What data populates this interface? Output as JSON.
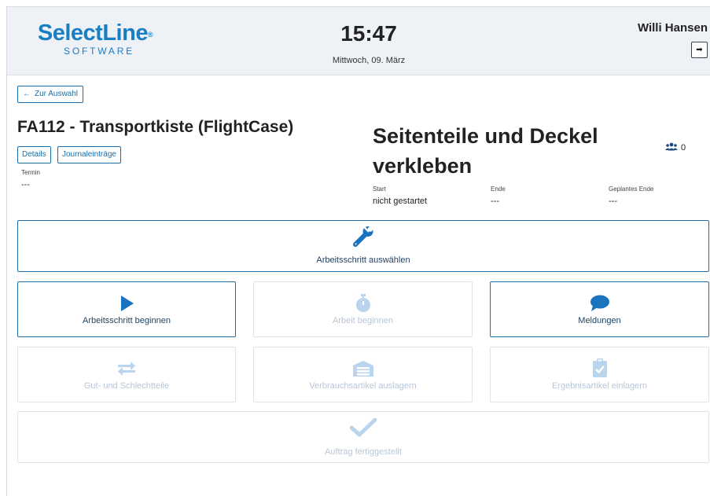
{
  "header": {
    "logo_main": "SelectLine",
    "logo_reg": "®",
    "logo_sub": "SOFTWARE",
    "time": "15:47",
    "date": "Mittwoch, 09. März",
    "user_name": "Willi Hansen",
    "logout_glyph": "➡"
  },
  "nav": {
    "back_arrow": "←",
    "back_label": "Zur Auswahl"
  },
  "order": {
    "title": "FA112 - Transportkiste (FlightCase)",
    "tab_details": "Details",
    "tab_journal": "Journaleinträge",
    "termin_label": "Termin",
    "termin_value": "---"
  },
  "step": {
    "title": "Seitenteile und Deckel verkleben",
    "worker_count": "0",
    "start_label": "Start",
    "start_value": "nicht gestartet",
    "end_label": "Ende",
    "end_value": "---",
    "planned_end_label": "Geplantes Ende",
    "planned_end_value": "---"
  },
  "actions": {
    "select_step": "Arbeitsschritt auswählen",
    "begin_step": "Arbeitsschritt beginnen",
    "begin_work": "Arbeit beginnen",
    "messages": "Meldungen",
    "good_bad_parts": "Gut- und Schlechtteile",
    "consumables_out": "Verbrauchsartikel auslagern",
    "results_in": "Ergebnisartikel einlagern",
    "order_done": "Auftrag fertiggestellt"
  },
  "colors": {
    "brand": "#1a7fc2",
    "active_border": "#1f6fa9",
    "disabled_icon": "#b9d5ee",
    "active_icon": "#1a73bf"
  },
  "icons": {
    "select_step": "wrench-icon",
    "begin_step": "play-icon",
    "begin_work": "stopwatch-icon",
    "messages": "speech-bubble-icon",
    "good_bad_parts": "exchange-arrows-icon",
    "consumables_out": "warehouse-icon",
    "results_in": "clipboard-check-icon",
    "order_done": "checkmark-icon",
    "workers": "users-icon",
    "logout": "sign-out-icon",
    "back": "arrow-left-icon"
  }
}
